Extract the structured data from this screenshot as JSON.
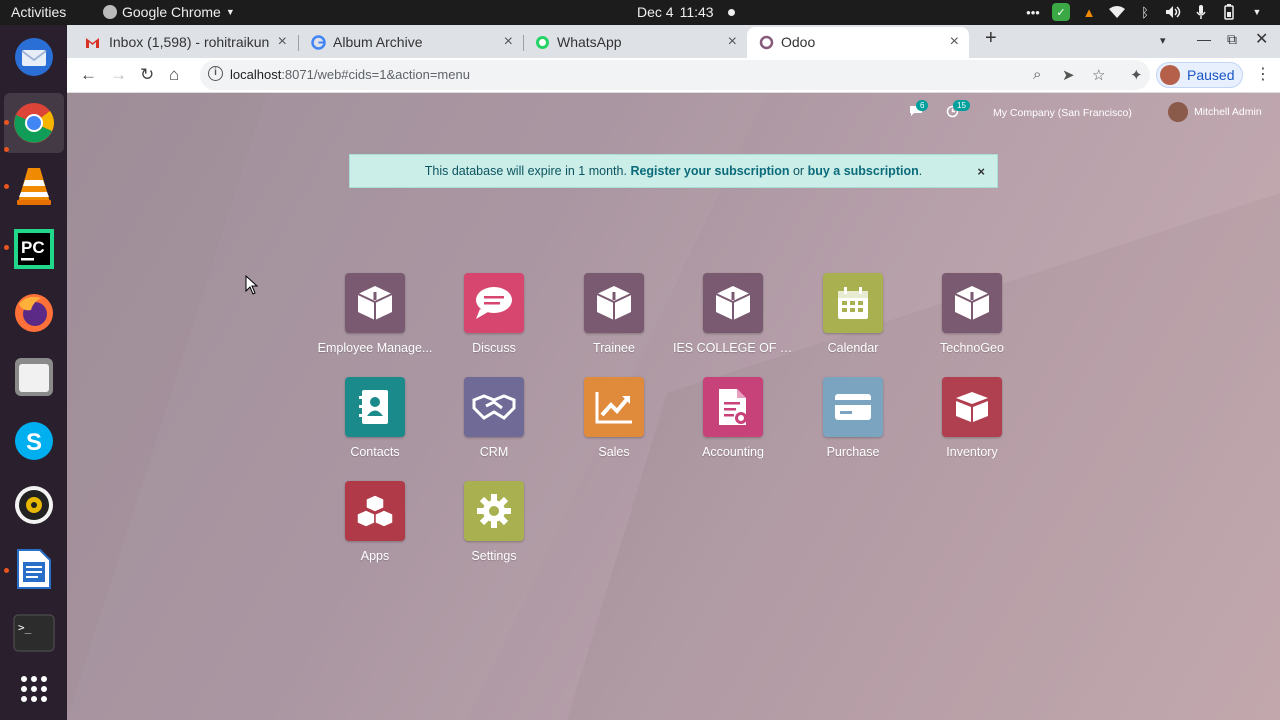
{
  "os": {
    "activities": "Activities",
    "app_menu": "Google Chrome",
    "date": "Dec 4",
    "time": "11:43"
  },
  "tabs": [
    {
      "title": "Inbox (1,598) - rohitraikun",
      "favicon": "gmail-icon",
      "color": "#d93025"
    },
    {
      "title": "Album Archive",
      "favicon": "google-icon",
      "color": "#4285f4"
    },
    {
      "title": "WhatsApp",
      "favicon": "whatsapp-icon",
      "color": "#25d366"
    },
    {
      "title": "Odoo",
      "favicon": "odoo-icon",
      "color": "#875a7b"
    }
  ],
  "toolbar": {
    "url_host": "localhost",
    "url_rest": ":8071/web#cids=1&action=menu",
    "profile_label": "Paused"
  },
  "odoo": {
    "messages_count": "6",
    "activities_count": "15",
    "company": "My Company (San Francisco)",
    "user": "Mitchell Admin",
    "alert_text": "This database will expire in 1 month.",
    "alert_link1": "Register your subscription",
    "alert_or": "or",
    "alert_link2": "buy a subscription",
    "alert_end": ".",
    "apps": [
      {
        "label": "Employee Manage...",
        "icon": "module-box-icon",
        "color": "#7a5a70"
      },
      {
        "label": "Discuss",
        "icon": "chat-bubble-icon",
        "color": "#d6466f"
      },
      {
        "label": "Trainee",
        "icon": "module-box-icon",
        "color": "#7a5a70"
      },
      {
        "label": "IES COLLEGE OF T...",
        "icon": "module-box-icon",
        "color": "#7a5a70"
      },
      {
        "label": "Calendar",
        "icon": "calendar-icon",
        "color": "#a8b04f"
      },
      {
        "label": "TechnoGeo",
        "icon": "module-box-icon",
        "color": "#7a5a70"
      },
      {
        "label": "Contacts",
        "icon": "contact-card-icon",
        "color": "#1b8a8a"
      },
      {
        "label": "CRM",
        "icon": "handshake-icon",
        "color": "#6f6a96"
      },
      {
        "label": "Sales",
        "icon": "trend-chart-icon",
        "color": "#e08a3c"
      },
      {
        "label": "Accounting",
        "icon": "invoice-icon",
        "color": "#c8427a"
      },
      {
        "label": "Purchase",
        "icon": "credit-card-icon",
        "color": "#7aa4c0"
      },
      {
        "label": "Inventory",
        "icon": "package-icon",
        "color": "#b0404f"
      },
      {
        "label": "Apps",
        "icon": "cubes-icon",
        "color": "#b03a48"
      },
      {
        "label": "Settings",
        "icon": "gear-icon",
        "color": "#a8b04f"
      }
    ]
  }
}
